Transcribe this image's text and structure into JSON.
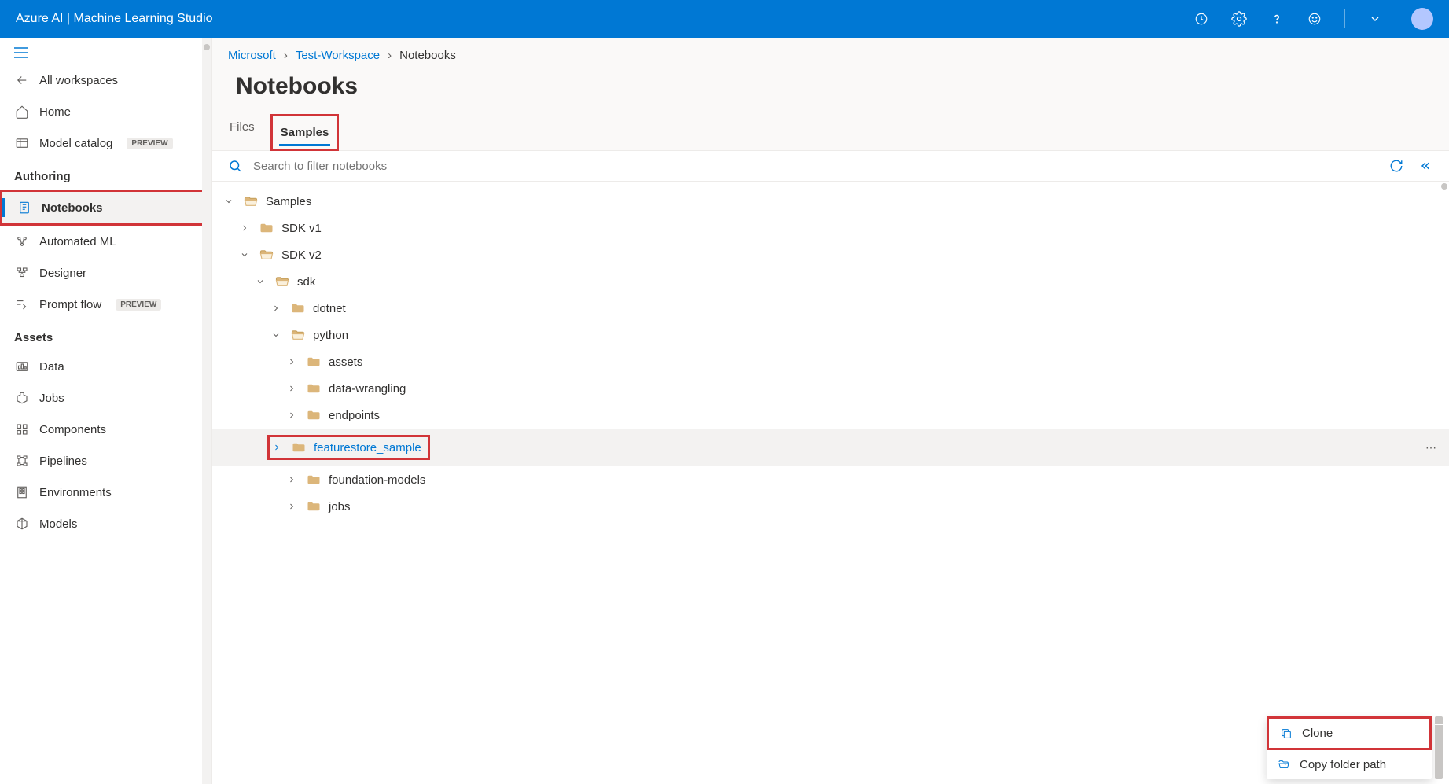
{
  "header": {
    "title": "Azure AI | Machine Learning Studio"
  },
  "sidebar": {
    "all_workspaces": "All workspaces",
    "home": "Home",
    "model_catalog": "Model catalog",
    "preview_badge": "PREVIEW",
    "section_authoring": "Authoring",
    "notebooks": "Notebooks",
    "automated_ml": "Automated ML",
    "designer": "Designer",
    "prompt_flow": "Prompt flow",
    "section_assets": "Assets",
    "data": "Data",
    "jobs": "Jobs",
    "components": "Components",
    "pipelines": "Pipelines",
    "environments": "Environments",
    "models": "Models"
  },
  "breadcrumb": {
    "item1": "Microsoft",
    "item2": "Test-Workspace",
    "item3": "Notebooks"
  },
  "page": {
    "title": "Notebooks"
  },
  "tabs": {
    "files": "Files",
    "samples": "Samples"
  },
  "search": {
    "placeholder": "Search to filter notebooks"
  },
  "tree": {
    "samples": "Samples",
    "sdk_v1": "SDK v1",
    "sdk_v2": "SDK v2",
    "sdk": "sdk",
    "dotnet": "dotnet",
    "python": "python",
    "assets": "assets",
    "data_wrangling": "data-wrangling",
    "endpoints": "endpoints",
    "featurestore_sample": "featurestore_sample",
    "foundation_models": "foundation-models",
    "jobs": "jobs"
  },
  "menu": {
    "clone": "Clone",
    "copy_path": "Copy folder path"
  }
}
